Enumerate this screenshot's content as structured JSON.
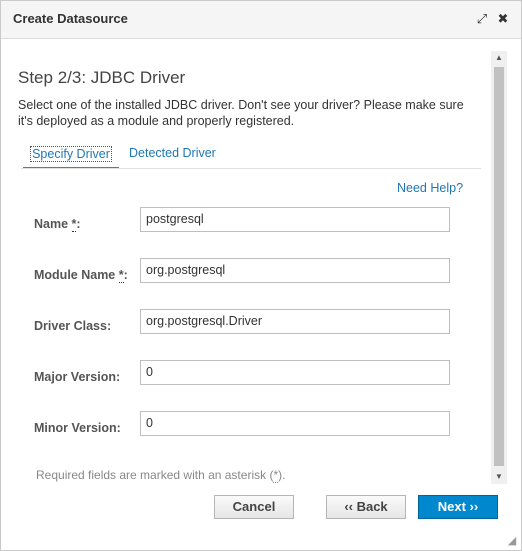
{
  "window": {
    "title": "Create Datasource",
    "maximize_icon": "⤢",
    "close_icon": "✖"
  },
  "step": {
    "title": "Step 2/3: JDBC Driver",
    "description": "Select one of the installed JDBC driver. Don't see your driver? Please make sure it's deployed as a module and properly registered."
  },
  "tabs": [
    {
      "label": "Specify Driver",
      "active": true
    },
    {
      "label": "Detected Driver",
      "active": false
    }
  ],
  "help_link": "Need Help?",
  "fields": {
    "name": {
      "label": "Name",
      "required_mark": "*",
      "suffix": ":",
      "value": "postgresql"
    },
    "module_name": {
      "label": "Module Name",
      "required_mark": "*",
      "suffix": ":",
      "value": "org.postgresql"
    },
    "driver_class": {
      "label": "Driver Class:",
      "value": "org.postgresql.Driver"
    },
    "major_version": {
      "label": "Major Version:",
      "value": "0"
    },
    "minor_version": {
      "label": "Minor Version:",
      "value": "0"
    }
  },
  "footnote": {
    "before": "Required fields are marked with an asterisk (",
    "mark": "*",
    "after": ")."
  },
  "buttons": {
    "cancel": "Cancel",
    "back": "‹‹ Back",
    "next": "Next ››"
  },
  "scrollbar": {
    "up_icon": "▲",
    "down_icon": "▼"
  },
  "colors": {
    "link": "#1f77b4",
    "primary_button": "#0088ce",
    "active_tab_underline": "#2d87c9"
  }
}
